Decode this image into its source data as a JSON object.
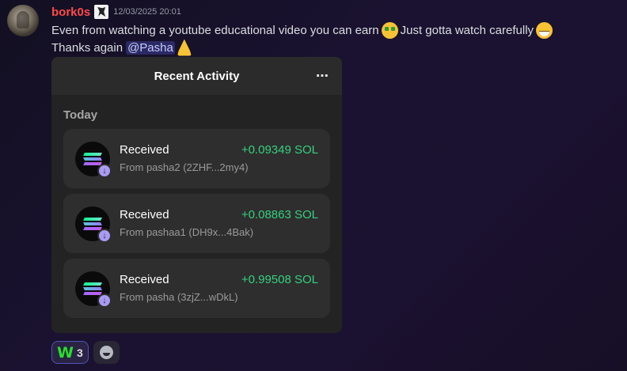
{
  "message": {
    "username": "bork0s",
    "timestamp": "12/03/2025 20:01",
    "line1_text": "Even from watching a youtube educational video you can earn",
    "line1_text2": "Just gotta watch carefully",
    "line2_text": "Thanks again",
    "mention": "@Pasha",
    "icons": [
      "money-mouth-face-emoji",
      "grinning-face-emoji",
      "folded-hands-emoji"
    ]
  },
  "card": {
    "title": "Recent Activity",
    "more_icon": "⋯",
    "section_label": "Today",
    "items": [
      {
        "title": "Received",
        "amount": "+0.09349 SOL",
        "from": "From pasha2 (2ZHF...2my4)"
      },
      {
        "title": "Received",
        "amount": "+0.08863 SOL",
        "from": "From pashaa1 (DH9x...4Bak)"
      },
      {
        "title": "Received",
        "amount": "+0.99508 SOL",
        "from": "From pasha (3zjZ...wDkL)"
      }
    ],
    "colors": {
      "amount": "#35d07f",
      "badge": "#a99bf5"
    }
  },
  "reactions": {
    "items": [
      {
        "emoji": "W",
        "count": "3"
      }
    ],
    "add_reaction_icon": "smiley-add-reaction-icon"
  }
}
